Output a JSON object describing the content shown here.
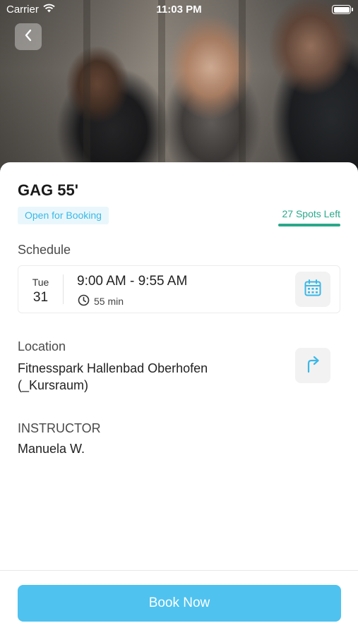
{
  "status_bar": {
    "carrier": "Carrier",
    "time": "11:03 PM"
  },
  "class": {
    "title": "GAG 55'",
    "status": "Open for Booking",
    "spots_left": "27 Spots Left"
  },
  "schedule": {
    "label": "Schedule",
    "weekday": "Tue",
    "day": "31",
    "time_range": "9:00 AM - 9:55 AM",
    "duration": "55 min"
  },
  "location": {
    "label": "Location",
    "name": "Fitnesspark Hallenbad Oberhofen (_Kursraum)"
  },
  "instructor": {
    "label": "INSTRUCTOR",
    "name": "Manuela W."
  },
  "footer": {
    "book_label": "Book Now"
  },
  "icons": {
    "back": "chevron-left-icon",
    "calendar": "calendar-icon",
    "directions": "turn-right-arrow-icon",
    "clock": "clock-icon",
    "wifi": "wifi-icon",
    "battery": "battery-icon"
  },
  "colors": {
    "accent": "#4fc2ef",
    "badge_text": "#3bb8e6",
    "badge_bg": "#e9f7fc",
    "spots": "#2aa88a"
  }
}
